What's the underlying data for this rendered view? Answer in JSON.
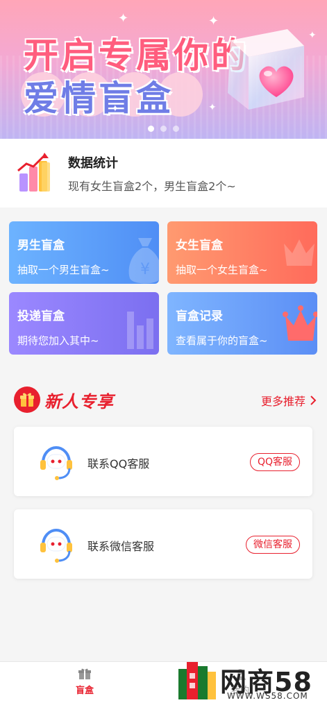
{
  "banner": {
    "line1": "开启专属你的",
    "line2": "爱情盲盒",
    "slide_count": 3,
    "active_slide": 1
  },
  "stats": {
    "icon": "bar-chart-icon",
    "title": "数据统计",
    "subtitle": "现有女生盲盒2个，男生盲盒2个~"
  },
  "cards": [
    {
      "title": "男生盲盒",
      "subtitle": "抽取一个男生盲盒~",
      "icon": "money-bag-icon",
      "color": "#4f8ef5"
    },
    {
      "title": "女生盲盒",
      "subtitle": "抽取一个女生盲盒~",
      "icon": "crown-icon",
      "color": "#ff6b5b"
    },
    {
      "title": "投递盲盒",
      "subtitle": "期待您加入其中~",
      "icon": "bar-chart-icon",
      "color": "#7b6ff0"
    },
    {
      "title": "盲盒记录",
      "subtitle": "查看属于你的盲盒~",
      "icon": "crown-icon",
      "color": "#5b8ef5"
    }
  ],
  "newbie": {
    "title": "新人专享",
    "more_label": "更多推荐",
    "icon": "gift-icon",
    "accent": "#e8202e"
  },
  "services": [
    {
      "label": "联系QQ客服",
      "button": "QQ客服",
      "icon": "headset-icon"
    },
    {
      "label": "联系微信客服",
      "button": "微信客服",
      "icon": "headset-icon"
    }
  ],
  "tabbar": {
    "tab1_label": "盲盒",
    "tab2_label": "我的"
  },
  "watermark": {
    "brand": "网商58",
    "url": "WWW.WS58.COM"
  }
}
